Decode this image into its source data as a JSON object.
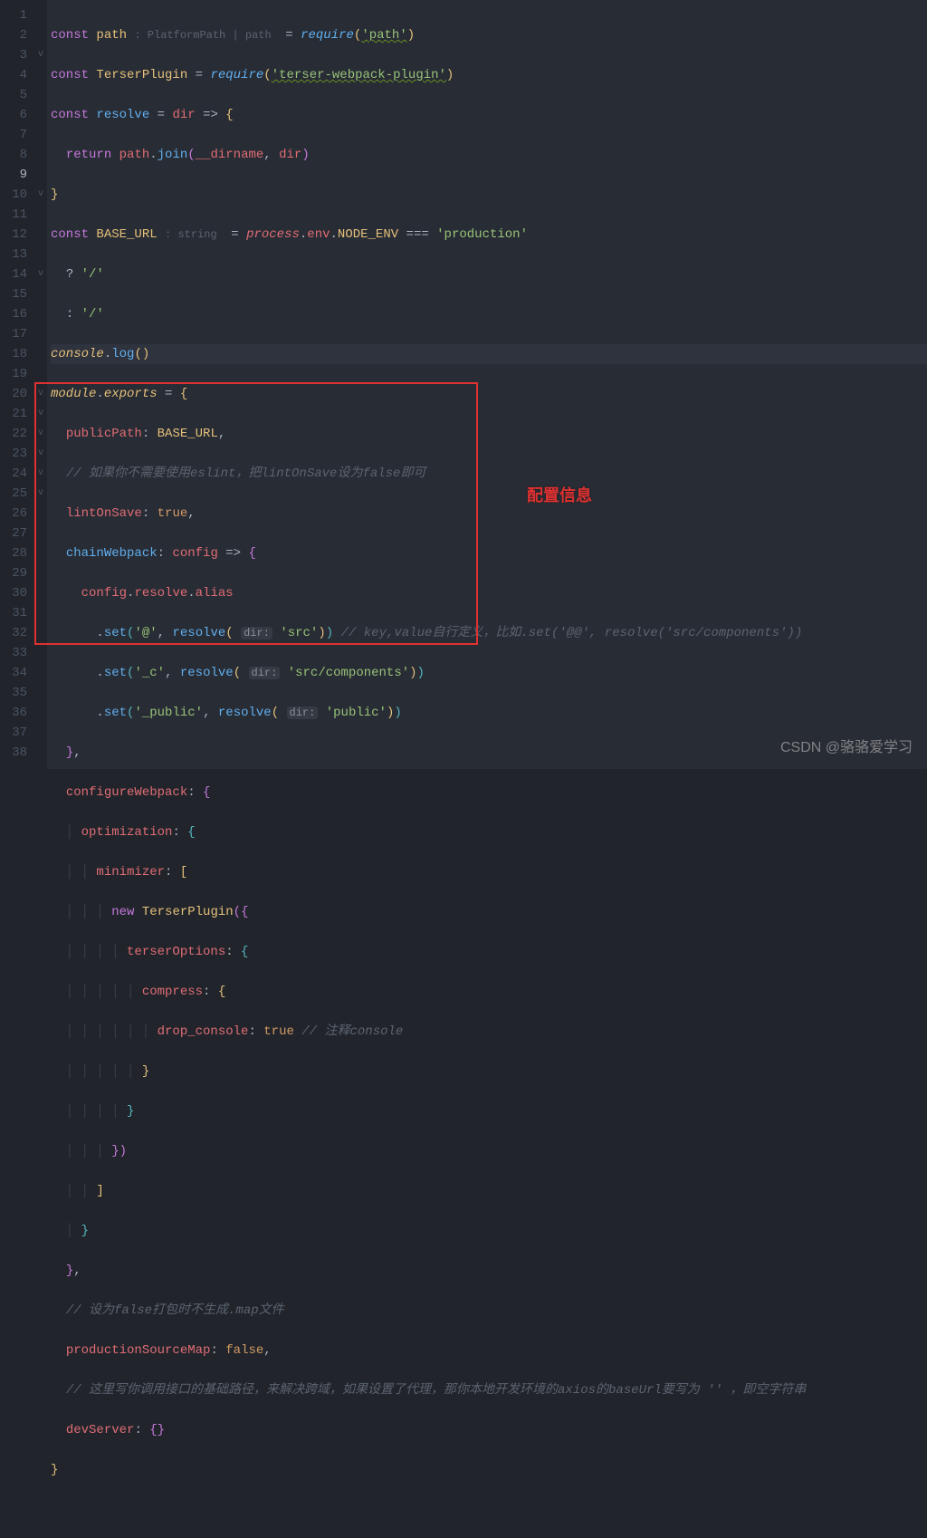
{
  "annotation": "配置信息",
  "watermark": "CSDN @骆骆爱学习",
  "activeLine": 9,
  "gutter": [
    "1",
    "2",
    "3",
    "4",
    "5",
    "6",
    "7",
    "8",
    "9",
    "10",
    "11",
    "12",
    "13",
    "14",
    "15",
    "16",
    "17",
    "18",
    "19",
    "20",
    "21",
    "22",
    "23",
    "24",
    "25",
    "26",
    "27",
    "28",
    "29",
    "30",
    "31",
    "32",
    "33",
    "34",
    "35",
    "36",
    "37",
    "38"
  ],
  "fold": {
    "3": "v",
    "10": "v",
    "14": "v",
    "20": "v",
    "21": "v",
    "22": "v",
    "23": "v",
    "24": "v",
    "25": "v"
  },
  "tokens": {
    "kw_const": "const",
    "kw_return": "return",
    "kw_new": "new",
    "kw_true": "true",
    "kw_false": "false",
    "path": "path",
    "TerserPlugin": "TerserPlugin",
    "resolve": "resolve",
    "BASE_URL": "BASE_URL",
    "require": "require",
    "join": "join",
    "log": "log",
    "set": "set",
    "process": "process",
    "env": "env",
    "NODE_ENV": "NODE_ENV",
    "console": "console",
    "module": "module",
    "exports": "exports",
    "dir": "dir",
    "__dirname": "__dirname",
    "config": "config",
    "alias": "alias",
    "publicPath": "publicPath",
    "lintOnSave": "lintOnSave",
    "chainWebpack": "chainWebpack",
    "configureWebpack": "configureWebpack",
    "optimization": "optimization",
    "minimizer": "minimizer",
    "terserOptions": "terserOptions",
    "compress": "compress",
    "drop_console": "drop_console",
    "productionSourceMap": "productionSourceMap",
    "devServer": "devServer",
    "s_path": "'path'",
    "s_terser": "'terser-webpack-plugin'",
    "s_production": "'production'",
    "s_slash": "'/'",
    "s_at": "'@'",
    "s_src": "'src'",
    "s_c": "'_c'",
    "s_srccomp": "'src/components'",
    "s_public_key": "'_public'",
    "s_public": "'public'",
    "s_atat": "'@@'",
    "hint_path": ": PlatformPath | path ",
    "hint_string": ": string ",
    "hint_dir": "dir:",
    "eq": " = ",
    "eqeqeq": " === ",
    "arrow": " => ",
    "q": "?",
    "colon": ":",
    "comma": ",",
    "dot": ".",
    "lp": "(",
    "rp": ")",
    "lb": "{",
    "rb": "}",
    "lsq": "[",
    "rsq": "]",
    "c12": "// 如果你不需要使用eslint，把lintOnSave设为false即可",
    "c15": "// key,value自行定义，比如.set('@@', resolve('src/components'))",
    "c26": "// 注释console",
    "c33": "// 设为false打包时不生成.map文件",
    "c35": "// 这里写你调用接口的基础路径，来解决跨域，如果设置了代理，那你本地开发环境的axios的baseUrl要写为 '' ，即空字符串"
  }
}
